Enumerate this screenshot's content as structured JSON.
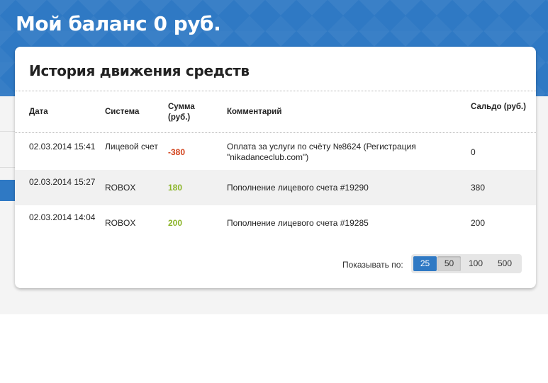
{
  "header": {
    "balance_title": "Мой баланс 0 руб."
  },
  "history": {
    "title": "История движения средств",
    "columns": {
      "date": "Дата",
      "system": "Система",
      "sum": "Сумма (руб.)",
      "comment": "Комментарий",
      "saldo": "Сальдо (руб.)"
    },
    "rows": [
      {
        "date": "02.03.2014 15:41",
        "system": "Лицевой счет",
        "sum": "-380",
        "comment": "Оплата за услуги по счёту №8624 (Регистрация \"nikadanceclub.com\")",
        "saldo": "0"
      },
      {
        "date": "02.03.2014 15:27",
        "system": "ROBOX",
        "sum": "180",
        "comment": "Пополнение лицевого счета #19290",
        "saldo": "380"
      },
      {
        "date": "02.03.2014 14:04",
        "system": "ROBOX",
        "sum": "200",
        "comment": "Пополнение лицевого счета #19285",
        "saldo": "200"
      }
    ]
  },
  "pager": {
    "label": "Показывать по:",
    "options": [
      "25",
      "50",
      "100",
      "500"
    ],
    "selected": "25"
  },
  "colors": {
    "brand_blue": "#2f79c4",
    "negative": "#d13f18",
    "positive": "#8cb52a"
  }
}
